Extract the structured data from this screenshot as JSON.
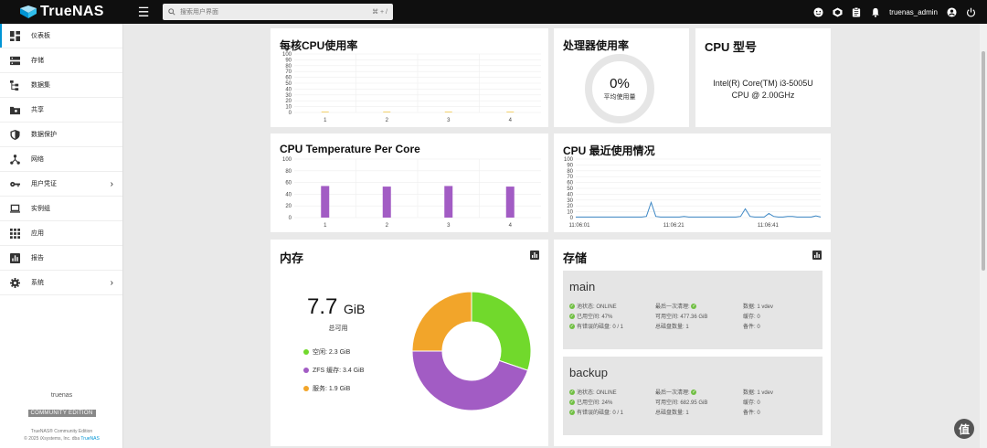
{
  "topbar": {
    "logo_main": "True",
    "logo_sub": "NAS",
    "search_placeholder": "搜索用户界面",
    "search_shortcut": "⌘ + /",
    "username": "truenas_admin"
  },
  "sidebar": {
    "items": [
      {
        "label": "仪表板",
        "icon": "dashboard-icon",
        "active": true
      },
      {
        "label": "存储",
        "icon": "storage-icon"
      },
      {
        "label": "数据集",
        "icon": "datasets-icon"
      },
      {
        "label": "共享",
        "icon": "shares-icon"
      },
      {
        "label": "数据保护",
        "icon": "shield-icon"
      },
      {
        "label": "网络",
        "icon": "network-icon"
      },
      {
        "label": "用户凭证",
        "icon": "key-icon",
        "has_chevron": true
      },
      {
        "label": "实例组",
        "icon": "laptop-icon"
      },
      {
        "label": "应用",
        "icon": "apps-grid-icon"
      },
      {
        "label": "报告",
        "icon": "reports-icon"
      },
      {
        "label": "系统",
        "icon": "gear-icon",
        "has_chevron": true
      }
    ],
    "hostname": "truenas",
    "edition": "COMMUNITY EDITION",
    "copyright_line1": "TrueNAS® Community Edition",
    "copyright_line2": "© 2025 iXsystems, Inc. dba",
    "copyright_link": "TrueNAS"
  },
  "cards": {
    "cpu_usage_per_core": {
      "title": "每核CPU使用率"
    },
    "processor_usage": {
      "title": "处理器使用率",
      "value": "0%",
      "label": "平均使用量"
    },
    "cpu_model": {
      "title": "CPU 型号",
      "line1": "Intel(R) Core(TM) i3-5005U",
      "line2": "CPU @ 2.00GHz"
    },
    "cpu_temp": {
      "title": "CPU Temperature Per Core"
    },
    "cpu_recent": {
      "title": "CPU 最近使用情况"
    },
    "memory": {
      "title": "内存",
      "total_value": "7.7",
      "total_unit": "GiB",
      "total_label": "总可用",
      "legend": [
        {
          "label": "空闲: 2.3 GiB",
          "color": "#71d92c"
        },
        {
          "label": "ZFS 缓存: 3.4 GiB",
          "color": "#a25cc4"
        },
        {
          "label": "服务: 1.9 GiB",
          "color": "#f2a52a"
        }
      ]
    },
    "storage": {
      "title": "存储",
      "pools": [
        {
          "name": "main",
          "status": "池状态: ONLINE",
          "used": "已用空间: 47%",
          "errors": "有错误的磁盘: 0 / 1",
          "last_scrub": "最后一次清理:",
          "free": "可用空间: 477.36 GiB",
          "total_disks": "总磁盘数量: 1",
          "data": "数据: 1 vdev",
          "cache": "缓存: 0",
          "spare": "备件: 0"
        },
        {
          "name": "backup",
          "status": "池状态: ONLINE",
          "used": "已用空间: 24%",
          "errors": "有错误的磁盘: 0 / 1",
          "last_scrub": "最后一次清理:",
          "free": "可用空间: 682.95 GiB",
          "total_disks": "总磁盘数量: 1",
          "data": "数据: 1 vdev",
          "cache": "缓存: 0",
          "spare": "备件: 0"
        }
      ]
    }
  },
  "chart_data": [
    {
      "type": "line",
      "categories": [
        "1",
        "2",
        "3",
        "4"
      ],
      "series": [
        {
          "values": [
            0,
            0,
            0,
            0
          ]
        }
      ],
      "yticks": [
        "0",
        "10",
        "20",
        "30",
        "40",
        "50",
        "60",
        "70",
        "80",
        "90",
        "100"
      ],
      "ylim": [
        0,
        100
      ]
    },
    {
      "type": "bar",
      "categories": [
        "1",
        "2",
        "3",
        "4"
      ],
      "values": [
        54,
        53,
        54,
        53
      ],
      "yticks": [
        "0",
        "20",
        "40",
        "60",
        "80",
        "100"
      ],
      "ylim": [
        0,
        100
      ],
      "color": "#a25cc4"
    },
    {
      "type": "line",
      "x": [
        "11:06:01",
        "11:06:21",
        "11:06:41"
      ],
      "series": [
        {
          "values": [
            1,
            1,
            1,
            1,
            1,
            1,
            1,
            1,
            1,
            1,
            1,
            1,
            1,
            1,
            1,
            2,
            26,
            2,
            1,
            1,
            1,
            1,
            1,
            2,
            1,
            1,
            1,
            1,
            1,
            1,
            1,
            1,
            1,
            1,
            1,
            2,
            15,
            2,
            1,
            1,
            1,
            7,
            2,
            1,
            1,
            2,
            2,
            1,
            1,
            1,
            1,
            3,
            1
          ]
        }
      ],
      "yticks": [
        "0",
        "10",
        "20",
        "30",
        "40",
        "50",
        "60",
        "70",
        "80",
        "90",
        "100"
      ],
      "ylim": [
        0,
        100
      ],
      "color": "#3b86c4"
    },
    {
      "type": "pie",
      "categories": [
        "空闲",
        "ZFS 缓存",
        "服务"
      ],
      "values": [
        2.3,
        3.4,
        1.9
      ],
      "colors": [
        "#71d92c",
        "#a25cc4",
        "#f2a52a"
      ]
    }
  ]
}
